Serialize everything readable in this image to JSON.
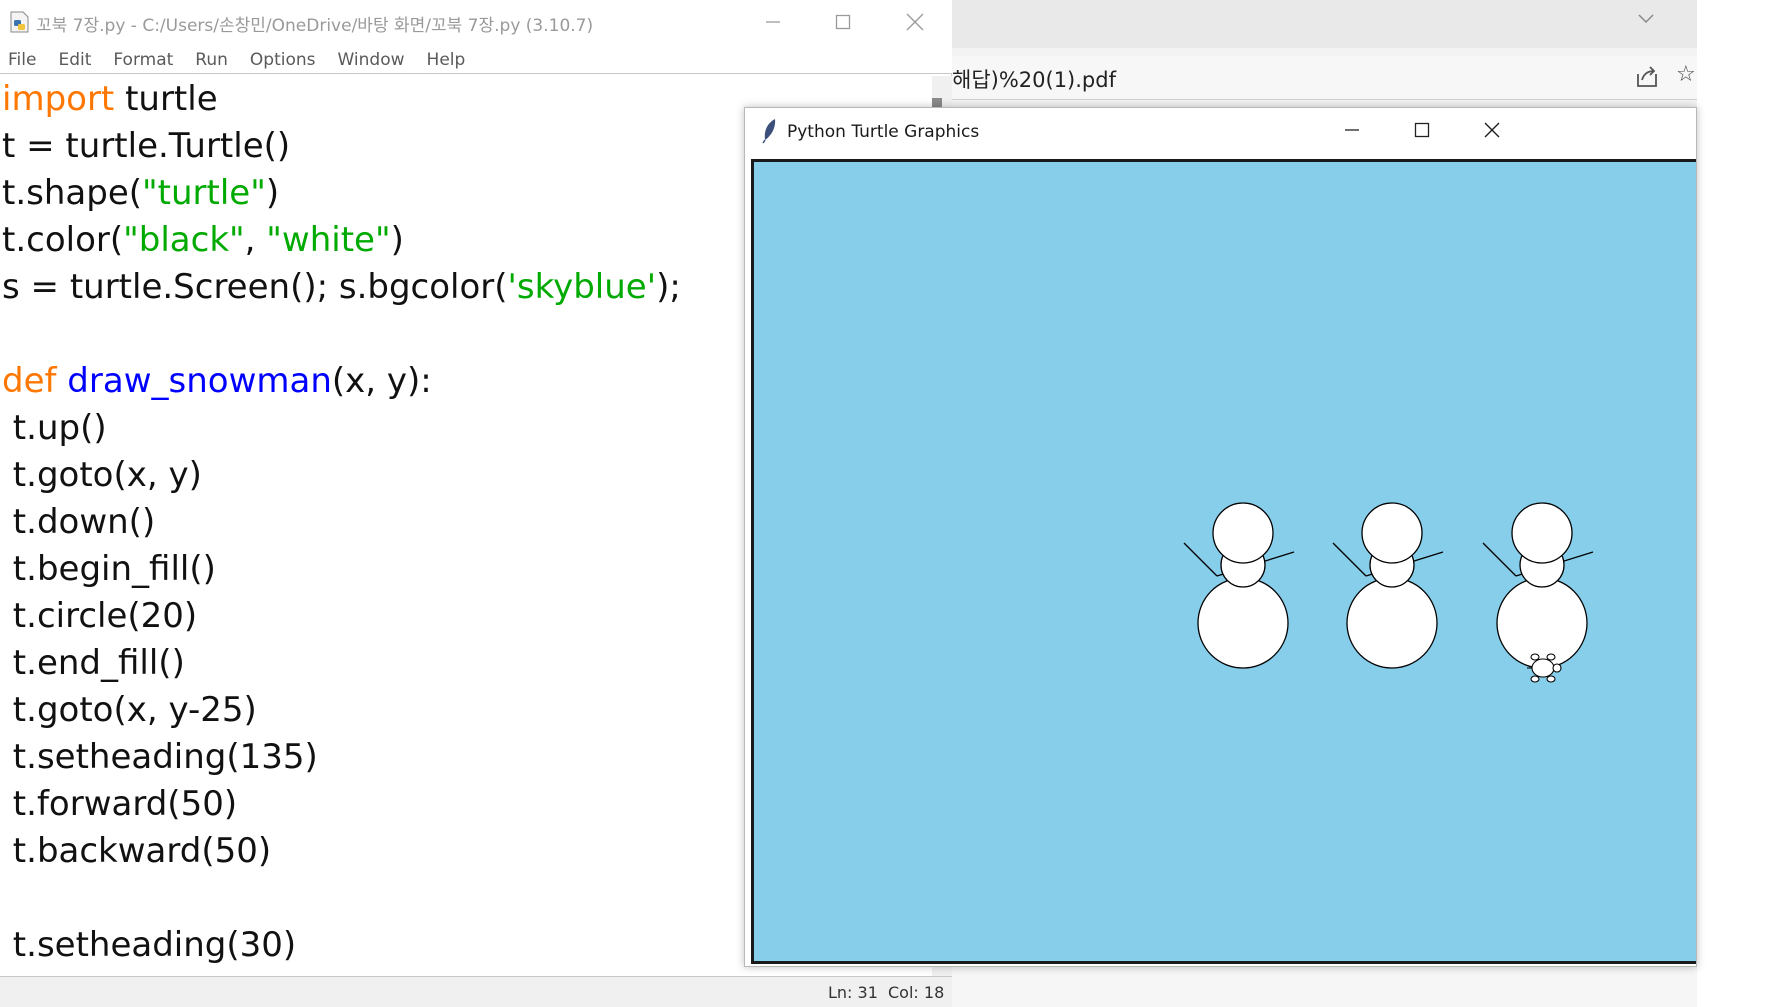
{
  "editor": {
    "title": "꼬북 7장.py - C:/Users/손창민/OneDrive/바탕 화면/꼬북 7장.py (3.10.7)",
    "menu": [
      "File",
      "Edit",
      "Format",
      "Run",
      "Options",
      "Window",
      "Help"
    ],
    "code_lines": [
      [
        {
          "t": "import",
          "c": "kw"
        },
        {
          "t": " turtle",
          "c": ""
        }
      ],
      [
        {
          "t": "t = turtle.Turtle()",
          "c": ""
        }
      ],
      [
        {
          "t": "t.shape(",
          "c": ""
        },
        {
          "t": "\"turtle\"",
          "c": "str"
        },
        {
          "t": ")",
          "c": ""
        }
      ],
      [
        {
          "t": "t.color(",
          "c": ""
        },
        {
          "t": "\"black\"",
          "c": "str"
        },
        {
          "t": ", ",
          "c": ""
        },
        {
          "t": "\"white\"",
          "c": "str"
        },
        {
          "t": ")",
          "c": ""
        }
      ],
      [
        {
          "t": "s = turtle.Screen(); s.bgcolor(",
          "c": ""
        },
        {
          "t": "'skyblue'",
          "c": "str"
        },
        {
          "t": ");",
          "c": ""
        }
      ],
      [],
      [
        {
          "t": "def",
          "c": "kw"
        },
        {
          "t": " ",
          "c": ""
        },
        {
          "t": "draw_snowman",
          "c": "fn"
        },
        {
          "t": "(x, y):",
          "c": ""
        }
      ],
      [
        {
          "t": " t.up()",
          "c": ""
        }
      ],
      [
        {
          "t": " t.goto(x, y)",
          "c": ""
        }
      ],
      [
        {
          "t": " t.down()",
          "c": ""
        }
      ],
      [
        {
          "t": " t.begin_fill()",
          "c": ""
        }
      ],
      [
        {
          "t": " t.circle(20)",
          "c": ""
        }
      ],
      [
        {
          "t": " t.end_fill()",
          "c": ""
        }
      ],
      [
        {
          "t": " t.goto(x, y-25)",
          "c": ""
        }
      ],
      [
        {
          "t": " t.setheading(135)",
          "c": ""
        }
      ],
      [
        {
          "t": " t.forward(50)",
          "c": ""
        }
      ],
      [
        {
          "t": " t.backward(50)",
          "c": ""
        }
      ],
      [],
      [
        {
          "t": " t.setheading(30)",
          "c": ""
        }
      ]
    ],
    "status": {
      "ln": "Ln: 31",
      "col": "Col: 18"
    }
  },
  "browser": {
    "address_fragment": "해답)%20(1).pdf"
  },
  "turtle_window": {
    "title": "Python Turtle Graphics",
    "background_color": "#87ceeb"
  },
  "colors": {
    "keyword": "#ff7700",
    "string": "#00aa00",
    "function_name": "#0000ff"
  },
  "icons": [
    "python-file-icon",
    "minimize-icon",
    "maximize-icon",
    "close-icon",
    "feather-icon",
    "chevron-down-icon",
    "share-icon",
    "star-icon"
  ]
}
